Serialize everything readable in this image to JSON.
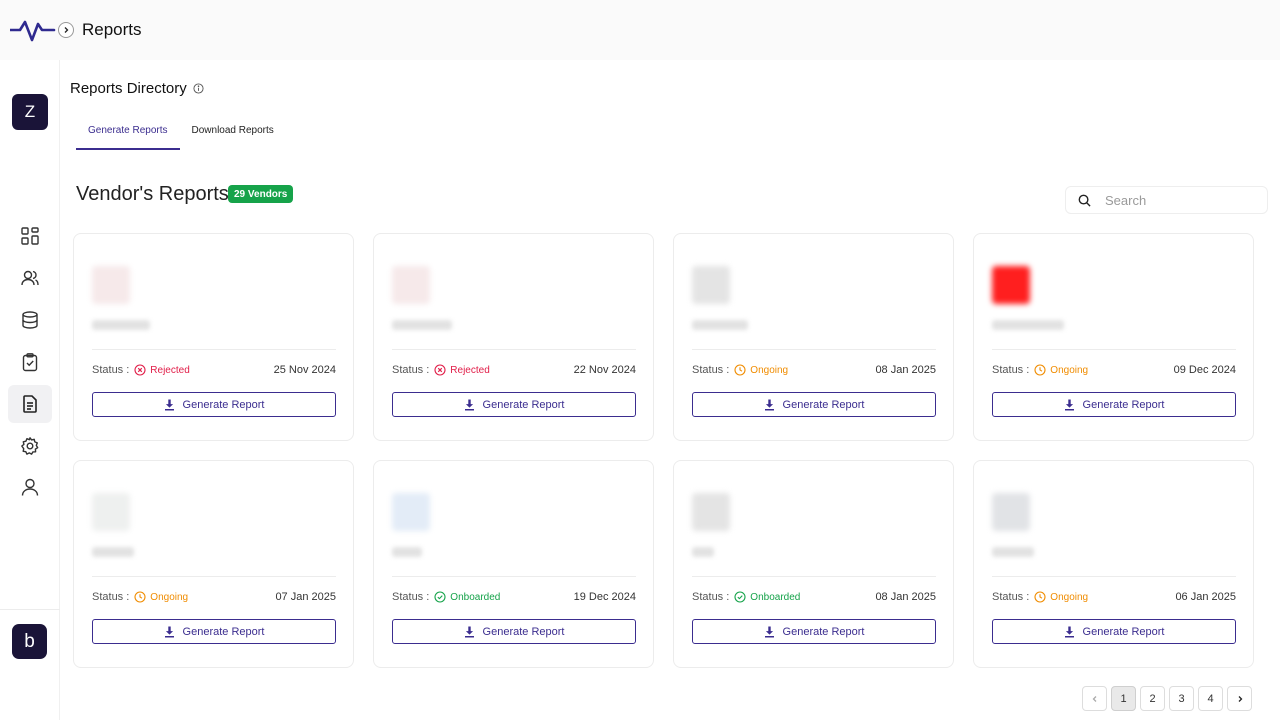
{
  "header": {
    "title": "Reports"
  },
  "sidebar": {
    "workspace_initial": "Z",
    "brand_initial": "b",
    "items": [
      {
        "icon": "dashboard-icon"
      },
      {
        "icon": "users-icon"
      },
      {
        "icon": "database-icon"
      },
      {
        "icon": "clipboard-check-icon"
      },
      {
        "icon": "document-icon",
        "active": true
      },
      {
        "icon": "gear-icon"
      },
      {
        "icon": "user-icon"
      }
    ]
  },
  "directory": {
    "title": "Reports Directory",
    "tabs": [
      {
        "label": "Generate Reports",
        "active": true
      },
      {
        "label": "Download Reports",
        "active": false
      }
    ]
  },
  "vendors": {
    "title": "Vendor's Reports",
    "count_badge": "29 Vendors",
    "search_placeholder": "Search",
    "status_label": "Status :",
    "button_label": "Generate Report",
    "cards": [
      {
        "status": "Rejected",
        "date": "25 Nov 2024"
      },
      {
        "status": "Rejected",
        "date": "22 Nov 2024"
      },
      {
        "status": "Ongoing",
        "date": "08 Jan 2025"
      },
      {
        "status": "Ongoing",
        "date": "09 Dec 2024"
      },
      {
        "status": "Ongoing",
        "date": "07 Jan 2025"
      },
      {
        "status": "Onboarded",
        "date": "19 Dec 2024"
      },
      {
        "status": "Onboarded",
        "date": "08 Jan 2025"
      },
      {
        "status": "Ongoing",
        "date": "06 Jan 2025"
      }
    ]
  },
  "pagination": {
    "pages": [
      "1",
      "2",
      "3",
      "4"
    ],
    "current": "1"
  },
  "colors": {
    "accent": "#3b2d8f",
    "rejected": "#e11d48",
    "ongoing": "#f08c00",
    "onboarded": "#16a34a",
    "badge": "#16a34a"
  }
}
